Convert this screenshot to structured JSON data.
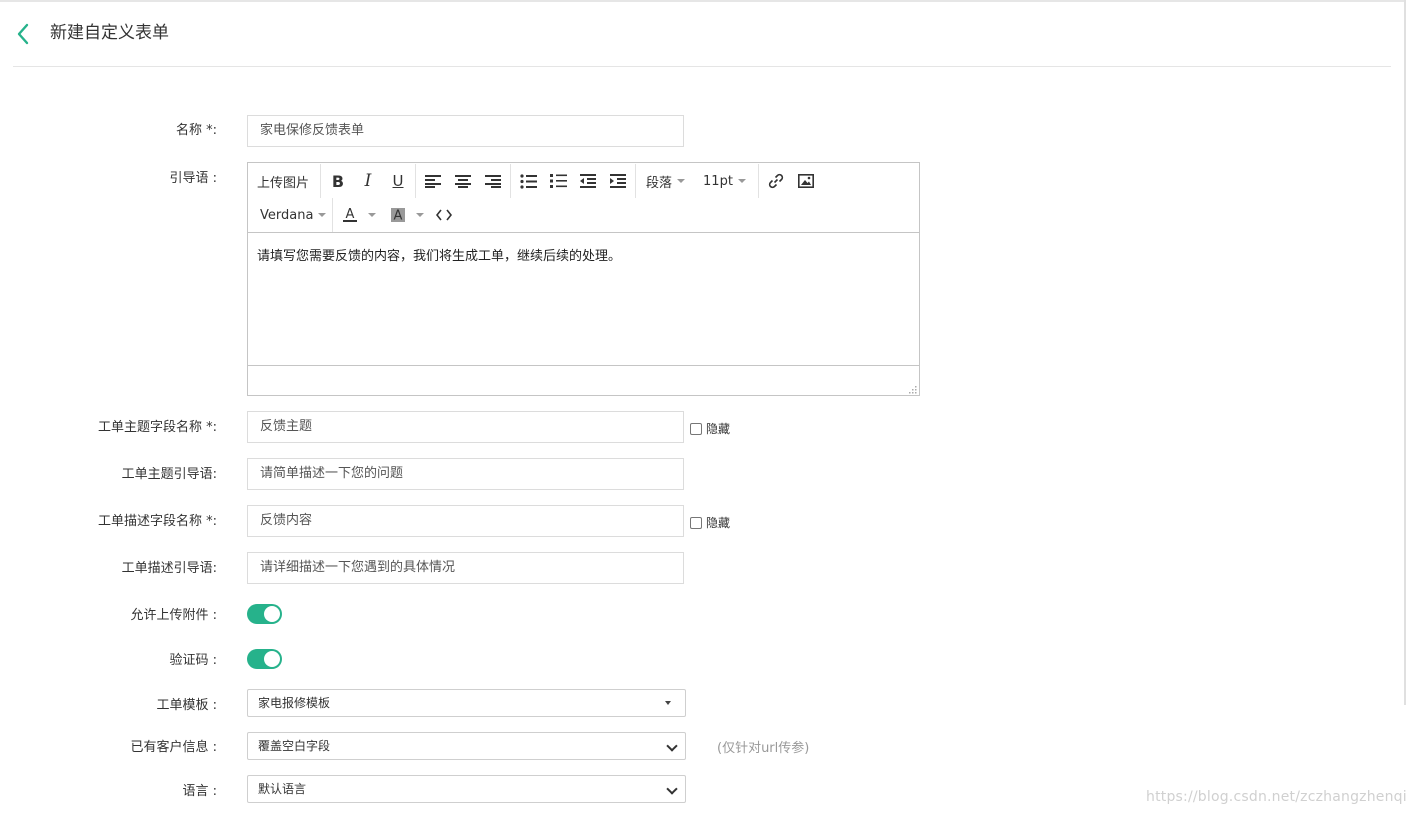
{
  "header": {
    "title": "新建自定义表单"
  },
  "form": {
    "name": {
      "label": "名称 *:",
      "value": "家电保修反馈表单"
    },
    "guide": {
      "label": "引导语 :",
      "toolbar": {
        "upload_image": "上传图片",
        "paragraph": "段落",
        "font_size": "11pt",
        "font_family": "Verdana"
      },
      "content": "请填写您需要反馈的内容，我们将生成工单，继续后续的处理。"
    },
    "subject_field": {
      "label": "工单主题字段名称 *:",
      "value": "反馈主题",
      "hide_label": "隐藏"
    },
    "subject_guide": {
      "label": "工单主题引导语:",
      "value": "请简单描述一下您的问题"
    },
    "desc_field": {
      "label": "工单描述字段名称 *:",
      "value": "反馈内容",
      "hide_label": "隐藏"
    },
    "desc_guide": {
      "label": "工单描述引导语:",
      "value": "请详细描述一下您遇到的具体情况"
    },
    "allow_upload": {
      "label": "允许上传附件 :"
    },
    "captcha": {
      "label": "验证码 :"
    },
    "template": {
      "label": "工单模板 :",
      "value": "家电报修模板"
    },
    "customer_info": {
      "label": "已有客户信息 :",
      "value": "覆盖空白字段",
      "hint": "(仅针对url传参)"
    },
    "language": {
      "label": "语言 :",
      "value": "默认语言"
    }
  },
  "watermark": "https://blog.csdn.net/zczhangzhenqi",
  "colors": {
    "accent": "#26b28b"
  }
}
